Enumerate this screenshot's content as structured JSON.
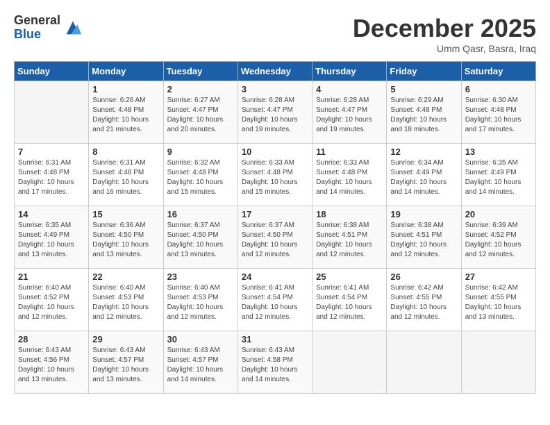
{
  "logo": {
    "general": "General",
    "blue": "Blue"
  },
  "header": {
    "month": "December 2025",
    "location": "Umm Qasr, Basra, Iraq"
  },
  "days_of_week": [
    "Sunday",
    "Monday",
    "Tuesday",
    "Wednesday",
    "Thursday",
    "Friday",
    "Saturday"
  ],
  "weeks": [
    [
      {
        "day": "",
        "sunrise": "",
        "sunset": "",
        "daylight": ""
      },
      {
        "day": "1",
        "sunrise": "6:26 AM",
        "sunset": "4:48 PM",
        "daylight": "10 hours and 21 minutes."
      },
      {
        "day": "2",
        "sunrise": "6:27 AM",
        "sunset": "4:47 PM",
        "daylight": "10 hours and 20 minutes."
      },
      {
        "day": "3",
        "sunrise": "6:28 AM",
        "sunset": "4:47 PM",
        "daylight": "10 hours and 19 minutes."
      },
      {
        "day": "4",
        "sunrise": "6:28 AM",
        "sunset": "4:47 PM",
        "daylight": "10 hours and 19 minutes."
      },
      {
        "day": "5",
        "sunrise": "6:29 AM",
        "sunset": "4:48 PM",
        "daylight": "10 hours and 18 minutes."
      },
      {
        "day": "6",
        "sunrise": "6:30 AM",
        "sunset": "4:48 PM",
        "daylight": "10 hours and 17 minutes."
      }
    ],
    [
      {
        "day": "7",
        "sunrise": "6:31 AM",
        "sunset": "4:48 PM",
        "daylight": "10 hours and 17 minutes."
      },
      {
        "day": "8",
        "sunrise": "6:31 AM",
        "sunset": "4:48 PM",
        "daylight": "10 hours and 16 minutes."
      },
      {
        "day": "9",
        "sunrise": "6:32 AM",
        "sunset": "4:48 PM",
        "daylight": "10 hours and 15 minutes."
      },
      {
        "day": "10",
        "sunrise": "6:33 AM",
        "sunset": "4:48 PM",
        "daylight": "10 hours and 15 minutes."
      },
      {
        "day": "11",
        "sunrise": "6:33 AM",
        "sunset": "4:48 PM",
        "daylight": "10 hours and 14 minutes."
      },
      {
        "day": "12",
        "sunrise": "6:34 AM",
        "sunset": "4:49 PM",
        "daylight": "10 hours and 14 minutes."
      },
      {
        "day": "13",
        "sunrise": "6:35 AM",
        "sunset": "4:49 PM",
        "daylight": "10 hours and 14 minutes."
      }
    ],
    [
      {
        "day": "14",
        "sunrise": "6:35 AM",
        "sunset": "4:49 PM",
        "daylight": "10 hours and 13 minutes."
      },
      {
        "day": "15",
        "sunrise": "6:36 AM",
        "sunset": "4:50 PM",
        "daylight": "10 hours and 13 minutes."
      },
      {
        "day": "16",
        "sunrise": "6:37 AM",
        "sunset": "4:50 PM",
        "daylight": "10 hours and 13 minutes."
      },
      {
        "day": "17",
        "sunrise": "6:37 AM",
        "sunset": "4:50 PM",
        "daylight": "10 hours and 12 minutes."
      },
      {
        "day": "18",
        "sunrise": "6:38 AM",
        "sunset": "4:51 PM",
        "daylight": "10 hours and 12 minutes."
      },
      {
        "day": "19",
        "sunrise": "6:38 AM",
        "sunset": "4:51 PM",
        "daylight": "10 hours and 12 minutes."
      },
      {
        "day": "20",
        "sunrise": "6:39 AM",
        "sunset": "4:52 PM",
        "daylight": "10 hours and 12 minutes."
      }
    ],
    [
      {
        "day": "21",
        "sunrise": "6:40 AM",
        "sunset": "4:52 PM",
        "daylight": "10 hours and 12 minutes."
      },
      {
        "day": "22",
        "sunrise": "6:40 AM",
        "sunset": "4:53 PM",
        "daylight": "10 hours and 12 minutes."
      },
      {
        "day": "23",
        "sunrise": "6:40 AM",
        "sunset": "4:53 PM",
        "daylight": "10 hours and 12 minutes."
      },
      {
        "day": "24",
        "sunrise": "6:41 AM",
        "sunset": "4:54 PM",
        "daylight": "10 hours and 12 minutes."
      },
      {
        "day": "25",
        "sunrise": "6:41 AM",
        "sunset": "4:54 PM",
        "daylight": "10 hours and 12 minutes."
      },
      {
        "day": "26",
        "sunrise": "6:42 AM",
        "sunset": "4:55 PM",
        "daylight": "10 hours and 12 minutes."
      },
      {
        "day": "27",
        "sunrise": "6:42 AM",
        "sunset": "4:55 PM",
        "daylight": "10 hours and 13 minutes."
      }
    ],
    [
      {
        "day": "28",
        "sunrise": "6:43 AM",
        "sunset": "4:56 PM",
        "daylight": "10 hours and 13 minutes."
      },
      {
        "day": "29",
        "sunrise": "6:43 AM",
        "sunset": "4:57 PM",
        "daylight": "10 hours and 13 minutes."
      },
      {
        "day": "30",
        "sunrise": "6:43 AM",
        "sunset": "4:57 PM",
        "daylight": "10 hours and 14 minutes."
      },
      {
        "day": "31",
        "sunrise": "6:43 AM",
        "sunset": "4:58 PM",
        "daylight": "10 hours and 14 minutes."
      },
      {
        "day": "",
        "sunrise": "",
        "sunset": "",
        "daylight": ""
      },
      {
        "day": "",
        "sunrise": "",
        "sunset": "",
        "daylight": ""
      },
      {
        "day": "",
        "sunrise": "",
        "sunset": "",
        "daylight": ""
      }
    ]
  ]
}
